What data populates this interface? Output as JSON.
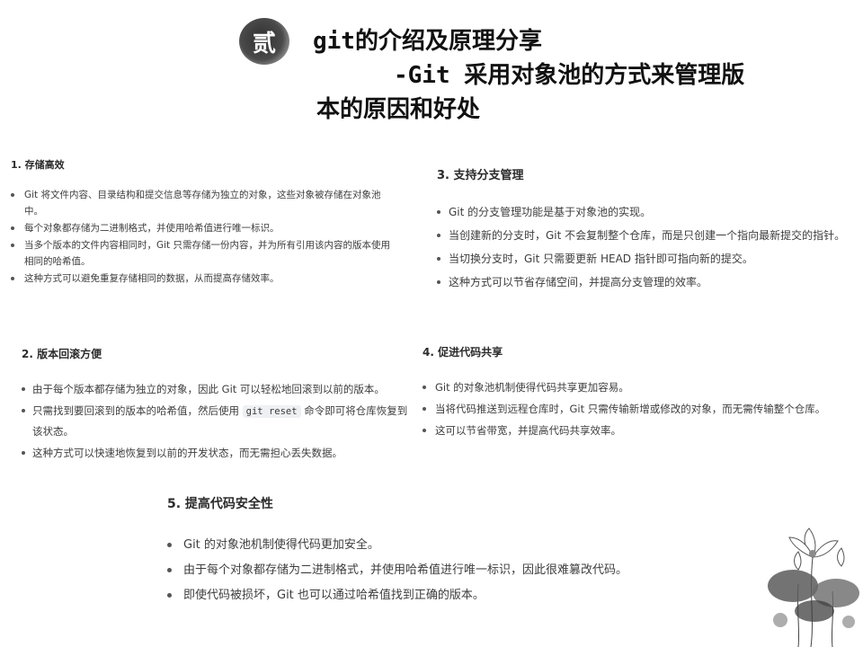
{
  "title": {
    "badge": "贰",
    "line1": "git的介绍及原理分享",
    "line2": "-Git 采用对象池的方式来管理版",
    "line3": "本的原因和好处"
  },
  "sections": [
    {
      "heading": "1. 存储高效",
      "items": [
        "Git 将文件内容、目录结构和提交信息等存储为独立的对象，这些对象被存储在对象池中。",
        "每个对象都存储为二进制格式，并使用哈希值进行唯一标识。",
        "当多个版本的文件内容相同时，Git 只需存储一份内容，并为所有引用该内容的版本使用相同的哈希值。",
        "这种方式可以避免重复存储相同的数据，从而提高存储效率。"
      ]
    },
    {
      "heading": "2. 版本回滚方便",
      "items": [
        "由于每个版本都存储为独立的对象，因此 Git 可以轻松地回滚到以前的版本。",
        {
          "before": "只需找到要回滚到的版本的哈希值，然后使用 ",
          "code": "git reset",
          "after": " 命令即可将仓库恢复到该状态。"
        },
        "这种方式可以快速地恢复到以前的开发状态，而无需担心丢失数据。"
      ]
    },
    {
      "heading": "3. 支持分支管理",
      "items": [
        "Git 的分支管理功能是基于对象池的实现。",
        "当创建新的分支时，Git 不会复制整个仓库，而是只创建一个指向最新提交的指针。",
        "当切换分支时，Git 只需要更新 HEAD 指针即可指向新的提交。",
        "这种方式可以节省存储空间，并提高分支管理的效率。"
      ]
    },
    {
      "heading": "4. 促进代码共享",
      "items": [
        "Git 的对象池机制使得代码共享更加容易。",
        "当将代码推送到远程仓库时，Git 只需传输新增或修改的对象，而无需传输整个仓库。",
        "这可以节省带宽，并提高代码共享效率。"
      ]
    },
    {
      "heading": "5. 提高代码安全性",
      "items": [
        "Git 的对象池机制使得代码更加安全。",
        "由于每个对象都存储为二进制格式，并使用哈希值进行唯一标识，因此很难篡改代码。",
        "即使代码被损坏，Git 也可以通过哈希值找到正确的版本。"
      ]
    }
  ],
  "decoration": {
    "icon": "lotus-icon"
  }
}
